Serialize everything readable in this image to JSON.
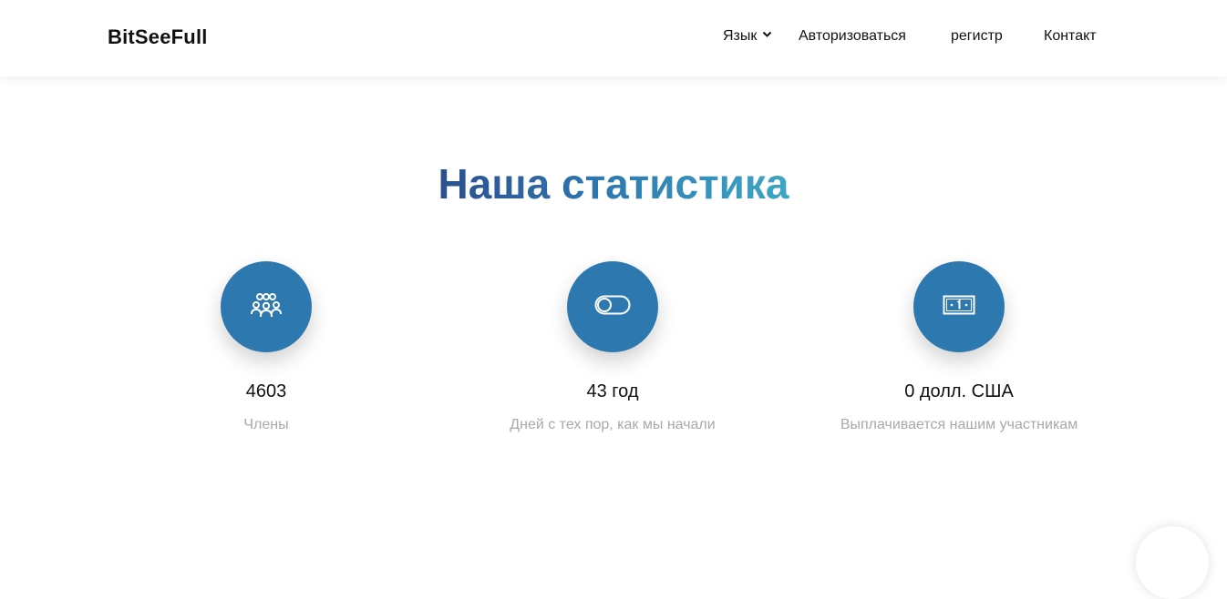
{
  "header": {
    "logo": "BitSeeFull",
    "nav": {
      "language": "Язык",
      "login": "Авторизоваться",
      "register": "регистр",
      "contact": "Контакт"
    }
  },
  "stats_section": {
    "title": "Наша статистика",
    "items": [
      {
        "icon": "users-group-icon",
        "value": "4603",
        "label": "Члены"
      },
      {
        "icon": "toggle-icon",
        "value": "43 год",
        "label": "Дней с тех пор, как мы начали"
      },
      {
        "icon": "banknote-icon",
        "value": "0 долл. США",
        "label": "Выплачивается нашим участникам"
      }
    ]
  },
  "colors": {
    "accent": "#2e78b0",
    "title_gradient_start": "#2b4f8e",
    "title_gradient_end": "#3ea6c4",
    "muted_text": "#a9a9a9"
  }
}
